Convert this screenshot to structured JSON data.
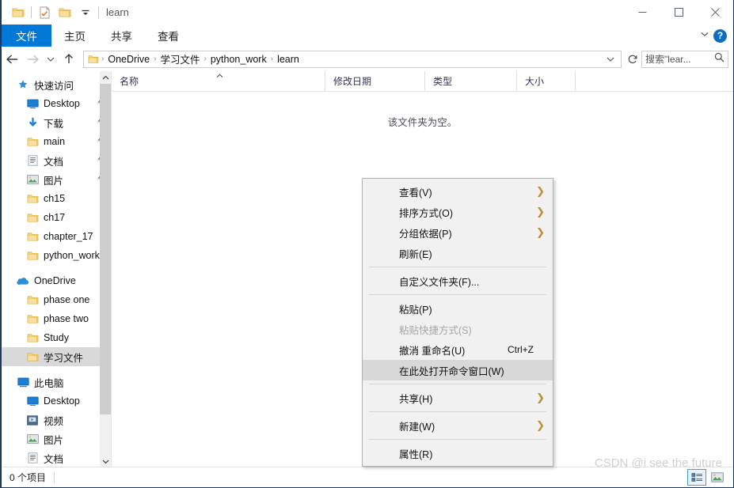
{
  "window": {
    "title": "learn",
    "quick_access_buttons": [
      {
        "name": "folder-icon",
        "label": "属性"
      },
      {
        "name": "new-folder-icon",
        "label": "新建文件夹"
      },
      {
        "name": "folder-customize-icon",
        "label": "自定义"
      },
      {
        "name": "chevron-down-icon",
        "label": "自定义快速访问工具栏"
      }
    ],
    "controls": {
      "minimize": "—",
      "maximize": "□",
      "close": "✕"
    }
  },
  "ribbon": {
    "tabs": [
      {
        "label": "文件",
        "active": true
      },
      {
        "label": "主页",
        "active": false
      },
      {
        "label": "共享",
        "active": false
      },
      {
        "label": "查看",
        "active": false
      }
    ],
    "collapse_label": "⌄",
    "help_label": "?"
  },
  "nav": {
    "back_label": "←",
    "forward_label": "→",
    "recent_label": "⌄",
    "up_label": "↑",
    "breadcrumbs": [
      "OneDrive",
      "学习文件",
      "python_work",
      "learn"
    ],
    "separator": "›",
    "dropdown_label": "⌄",
    "refresh_label": "↻"
  },
  "search": {
    "placeholder": "搜索\"lear...",
    "icon": "search-icon"
  },
  "sidebar": {
    "groups": [
      {
        "name": "快速访问",
        "icon": "star-pin-icon",
        "items": [
          {
            "label": "Desktop",
            "icon": "monitor-icon",
            "pinned": true
          },
          {
            "label": "下载",
            "icon": "download-icon",
            "pinned": true
          },
          {
            "label": "main",
            "icon": "folder-icon",
            "pinned": true
          },
          {
            "label": "文档",
            "icon": "document-icon",
            "pinned": true
          },
          {
            "label": "图片",
            "icon": "picture-icon",
            "pinned": true
          },
          {
            "label": "ch15",
            "icon": "folder-icon",
            "pinned": false
          },
          {
            "label": "ch17",
            "icon": "folder-icon",
            "pinned": false
          },
          {
            "label": "chapter_17",
            "icon": "folder-icon",
            "pinned": false
          },
          {
            "label": "python_work",
            "icon": "folder-icon",
            "pinned": false
          }
        ]
      },
      {
        "name": "OneDrive",
        "icon": "cloud-icon",
        "items": [
          {
            "label": "phase one",
            "icon": "folder-icon",
            "pinned": false
          },
          {
            "label": "phase two",
            "icon": "folder-icon",
            "pinned": false
          },
          {
            "label": "Study",
            "icon": "folder-icon",
            "pinned": false
          },
          {
            "label": "学习文件",
            "icon": "folder-icon",
            "pinned": false,
            "selected": true
          }
        ]
      },
      {
        "name": "此电脑",
        "icon": "computer-icon",
        "items": [
          {
            "label": "Desktop",
            "icon": "monitor-icon",
            "pinned": false
          },
          {
            "label": "视频",
            "icon": "video-icon",
            "pinned": false
          },
          {
            "label": "图片",
            "icon": "picture-icon",
            "pinned": false
          },
          {
            "label": "文档",
            "icon": "document-icon",
            "pinned": false
          }
        ]
      }
    ],
    "scroll_up": "⌃",
    "scroll_down": "⌄"
  },
  "filelist": {
    "columns": [
      "名称",
      "修改日期",
      "类型",
      "大小"
    ],
    "sort_indicator": "⌃",
    "empty_message": "该文件夹为空。",
    "rows": []
  },
  "context_menu": {
    "items": [
      {
        "label": "查看(V)",
        "submenu": true,
        "accel": "",
        "disabled": false,
        "highlight": false
      },
      {
        "label": "排序方式(O)",
        "submenu": true,
        "accel": "",
        "disabled": false,
        "highlight": false
      },
      {
        "label": "分组依据(P)",
        "submenu": true,
        "accel": "",
        "disabled": false,
        "highlight": false
      },
      {
        "label": "刷新(E)",
        "submenu": false,
        "accel": "",
        "disabled": false,
        "highlight": false
      },
      {
        "separator": true
      },
      {
        "label": "自定义文件夹(F)...",
        "submenu": false,
        "accel": "",
        "disabled": false,
        "highlight": false
      },
      {
        "separator": true
      },
      {
        "label": "粘贴(P)",
        "submenu": false,
        "accel": "",
        "disabled": false,
        "highlight": false
      },
      {
        "label": "粘贴快捷方式(S)",
        "submenu": false,
        "accel": "",
        "disabled": true,
        "highlight": false
      },
      {
        "label": "撤消 重命名(U)",
        "submenu": false,
        "accel": "Ctrl+Z",
        "disabled": false,
        "highlight": false
      },
      {
        "label": "在此处打开命令窗口(W)",
        "submenu": false,
        "accel": "",
        "disabled": false,
        "highlight": true
      },
      {
        "separator": true
      },
      {
        "label": "共享(H)",
        "submenu": true,
        "accel": "",
        "disabled": false,
        "highlight": false
      },
      {
        "separator": true
      },
      {
        "label": "新建(W)",
        "submenu": true,
        "accel": "",
        "disabled": false,
        "highlight": false
      },
      {
        "separator": true
      },
      {
        "label": "属性(R)",
        "submenu": false,
        "accel": "",
        "disabled": false,
        "highlight": false
      }
    ],
    "submenu_arrow": "❯"
  },
  "statusbar": {
    "item_count": "0 个项目",
    "view_buttons": [
      {
        "name": "details-view-icon",
        "active": true
      },
      {
        "name": "large-icons-view-icon",
        "active": false
      }
    ]
  },
  "watermark": "CSDN @i see the future",
  "colors": {
    "accent": "#0078d7",
    "selected_row": "#d9d9d9",
    "menu_highlight": "#d8d8d8",
    "folder_yellow": "#ffd96b",
    "submenu_arrow": "#c08a2e"
  }
}
